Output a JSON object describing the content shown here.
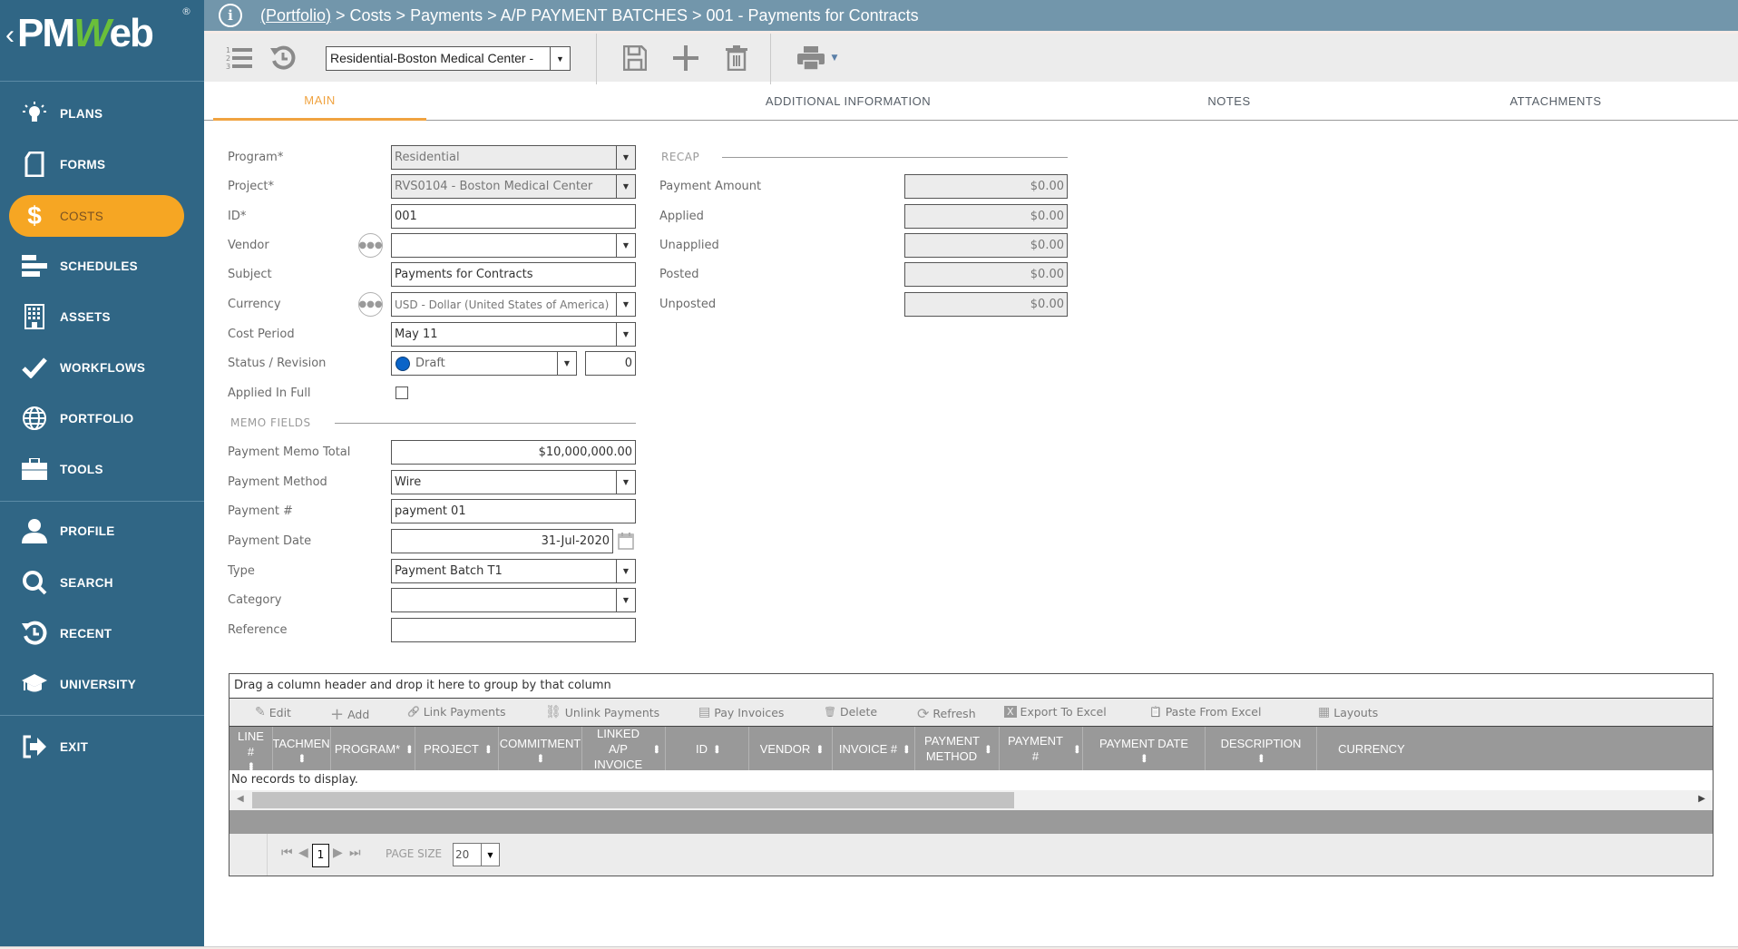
{
  "app": {
    "logo_text_pm": "PM",
    "logo_text_w": "W",
    "logo_text_eb": "eb",
    "logo_reg": "®",
    "back_chevron": "‹"
  },
  "sidebar": {
    "items": [
      {
        "label": "PLANS",
        "icon": "lightbulb-icon"
      },
      {
        "label": "FORMS",
        "icon": "document-icon"
      },
      {
        "label": "COSTS",
        "icon": "dollar-icon",
        "active": true
      },
      {
        "label": "SCHEDULES",
        "icon": "gantt-icon"
      },
      {
        "label": "ASSETS",
        "icon": "building-icon"
      },
      {
        "label": "WORKFLOWS",
        "icon": "checkmark-icon"
      },
      {
        "label": "PORTFOLIO",
        "icon": "globe-icon"
      },
      {
        "label": "TOOLS",
        "icon": "toolbox-icon"
      },
      {
        "label": "PROFILE",
        "icon": "user-icon"
      },
      {
        "label": "SEARCH",
        "icon": "search-icon"
      },
      {
        "label": "RECENT",
        "icon": "history-icon"
      },
      {
        "label": "UNIVERSITY",
        "icon": "graduation-cap-icon"
      },
      {
        "label": "EXIT",
        "icon": "exit-icon"
      }
    ]
  },
  "breadcrumb": {
    "portfolio_link": "(Portfolio)",
    "rest": " > Costs > Payments > A/P PAYMENT BATCHES > 001 - Payments for Contracts"
  },
  "toolbar": {
    "project_select_value": "Residential-Boston Medical Center -"
  },
  "tabs": [
    {
      "label": "MAIN",
      "active": true
    },
    {
      "label": "ADDITIONAL INFORMATION"
    },
    {
      "label": "NOTES"
    },
    {
      "label": "ATTACHMENTS"
    }
  ],
  "form": {
    "program": {
      "label": "Program*",
      "value": "Residential"
    },
    "project": {
      "label": "Project*",
      "value": "RVS0104 - Boston Medical Center"
    },
    "id": {
      "label": "ID*",
      "value": "001"
    },
    "vendor": {
      "label": "Vendor",
      "value": ""
    },
    "subject": {
      "label": "Subject",
      "value": "Payments for Contracts"
    },
    "currency": {
      "label": "Currency",
      "value": "USD - Dollar (United States of America)"
    },
    "cost_period": {
      "label": "Cost Period",
      "value": "May 11"
    },
    "status_revision": {
      "label": "Status / Revision",
      "status": "Draft",
      "status_color": "#0a64c8",
      "revision": "0"
    },
    "applied_in_full": {
      "label": "Applied In Full",
      "checked": false
    },
    "memo_section": "MEMO FIELDS",
    "payment_memo_total": {
      "label": "Payment Memo Total",
      "value": "$10,000,000.00"
    },
    "payment_method": {
      "label": "Payment Method",
      "value": "Wire"
    },
    "payment_number": {
      "label": "Payment #",
      "value": "payment 01"
    },
    "payment_date": {
      "label": "Payment Date",
      "value": "31-Jul-2020"
    },
    "type": {
      "label": "Type",
      "value": "Payment Batch T1"
    },
    "category": {
      "label": "Category",
      "value": ""
    },
    "reference": {
      "label": "Reference",
      "value": ""
    }
  },
  "recap": {
    "title": "RECAP",
    "rows": [
      {
        "label": "Payment Amount",
        "value": "$0.00"
      },
      {
        "label": "Applied",
        "value": "$0.00"
      },
      {
        "label": "Unapplied",
        "value": "$0.00"
      },
      {
        "label": "Posted",
        "value": "$0.00"
      },
      {
        "label": "Unposted",
        "value": "$0.00"
      }
    ]
  },
  "grid": {
    "group_hint": "Drag a column header and drop it here to group by that column",
    "toolbar": [
      {
        "label": "Edit",
        "icon": "pencil-icon",
        "glyph": "✎"
      },
      {
        "label": "Add",
        "icon": "plus-icon",
        "glyph": "+"
      },
      {
        "label": "Link Payments",
        "icon": "link-icon",
        "glyph": "🔗"
      },
      {
        "label": "Unlink Payments",
        "icon": "unlink-icon",
        "glyph": "⛓"
      },
      {
        "label": "Pay Invoices",
        "icon": "invoice-icon",
        "glyph": "▤"
      },
      {
        "label": "Delete",
        "icon": "trash-icon",
        "glyph": "🗑"
      },
      {
        "label": "Refresh",
        "icon": "refresh-icon",
        "glyph": "⟳"
      },
      {
        "label": "Export To Excel",
        "icon": "excel-icon",
        "glyph": "X"
      },
      {
        "label": "Paste From Excel",
        "icon": "clipboard-icon",
        "glyph": "📋"
      },
      {
        "label": "Layouts",
        "icon": "layout-grid-icon",
        "glyph": "▦"
      }
    ],
    "columns": [
      {
        "label": "LINE #"
      },
      {
        "label": "ATTACHMENTS"
      },
      {
        "label": "PROGRAM*"
      },
      {
        "label": "PROJECT"
      },
      {
        "label": "COMMITMENT"
      },
      {
        "label": "LINKED A/P INVOICE"
      },
      {
        "label": "ID"
      },
      {
        "label": "VENDOR"
      },
      {
        "label": "INVOICE #"
      },
      {
        "label": "PAYMENT METHOD"
      },
      {
        "label": "PAYMENT #"
      },
      {
        "label": "PAYMENT DATE"
      },
      {
        "label": "DESCRIPTION"
      },
      {
        "label": "CURRENCY"
      }
    ],
    "empty_text": "No records to display.",
    "scroll_fraction": 0.53,
    "pager": {
      "current_page": "1",
      "page_size_label": "PAGE SIZE",
      "page_size": "20"
    }
  }
}
